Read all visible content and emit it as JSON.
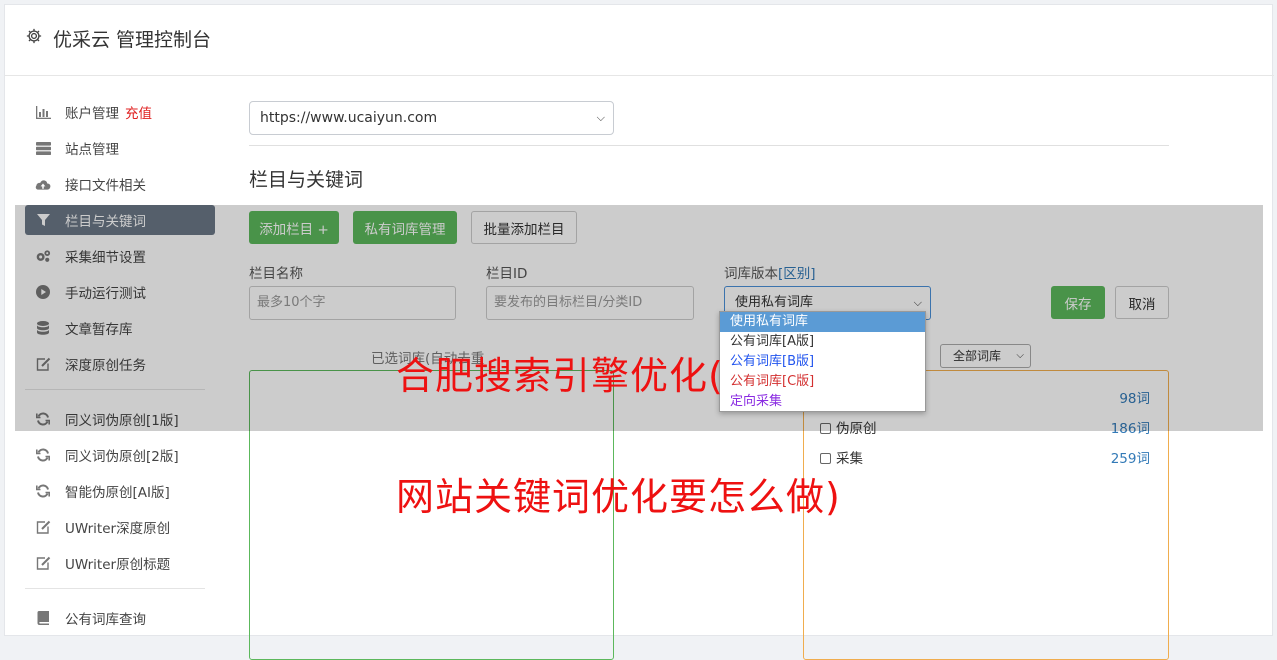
{
  "header": {
    "title": "优采云 管理控制台",
    "icon": "gear-icon"
  },
  "sidebar": {
    "items": [
      {
        "label": "账户管理",
        "badge": "充值",
        "icon": "bar-chart-icon"
      },
      {
        "label": "站点管理",
        "icon": "server-icon"
      },
      {
        "label": "接口文件相关",
        "icon": "cloud-upload-icon"
      },
      {
        "label": "栏目与关键词",
        "icon": "filter-icon",
        "active": true
      },
      {
        "label": "采集细节设置",
        "icon": "gears-icon"
      },
      {
        "label": "手动运行测试",
        "icon": "play-circle-icon"
      },
      {
        "label": "文章暂存库",
        "icon": "database-icon"
      },
      {
        "label": "深度原创任务",
        "icon": "edit-icon"
      },
      {
        "label": "同义词伪原创[1版]",
        "icon": "refresh-icon"
      },
      {
        "label": "同义词伪原创[2版]",
        "icon": "refresh-icon"
      },
      {
        "label": "智能伪原创[AI版]",
        "icon": "refresh-icon"
      },
      {
        "label": "UWriter深度原创",
        "icon": "edit-icon"
      },
      {
        "label": "UWriter原创标题",
        "icon": "edit-icon"
      },
      {
        "label": "公有词库查询",
        "icon": "book-icon"
      }
    ]
  },
  "main": {
    "site_select": "https://www.ucaiyun.com",
    "section_title": "栏目与关键词",
    "buttons": {
      "add_category": "添加栏目 +",
      "private_lexicon": "私有词库管理",
      "batch_add": "批量添加栏目",
      "save": "保存",
      "cancel": "取消"
    },
    "form": {
      "name_label": "栏目名称",
      "name_placeholder": "最多10个字",
      "id_label": "栏目ID",
      "id_placeholder": "要发布的目标栏目/分类ID",
      "version_label": "词库版本",
      "version_link": "[区别]",
      "version_value": "使用私有词库"
    },
    "dropdown_options": [
      "使用私有词库",
      "公有词库[A版]",
      "公有词库[B版]",
      "公有词库[C版]",
      "定向采集"
    ],
    "selected_label": "已选词库(自动去重",
    "all_lexicon": "全部词库",
    "categories": [
      {
        "label": "",
        "count": "98词"
      },
      {
        "label": "伪原创",
        "count": "186词"
      },
      {
        "label": "采集",
        "count": "259词"
      }
    ]
  },
  "overlay": {
    "line1": "合肥搜索引擎优化(",
    "line2": "网站关键词优化要怎么做)"
  },
  "colors": {
    "accent_green": "#5cb85c",
    "active_nav": "#6b7786",
    "overlay_text": "#ee1111"
  }
}
